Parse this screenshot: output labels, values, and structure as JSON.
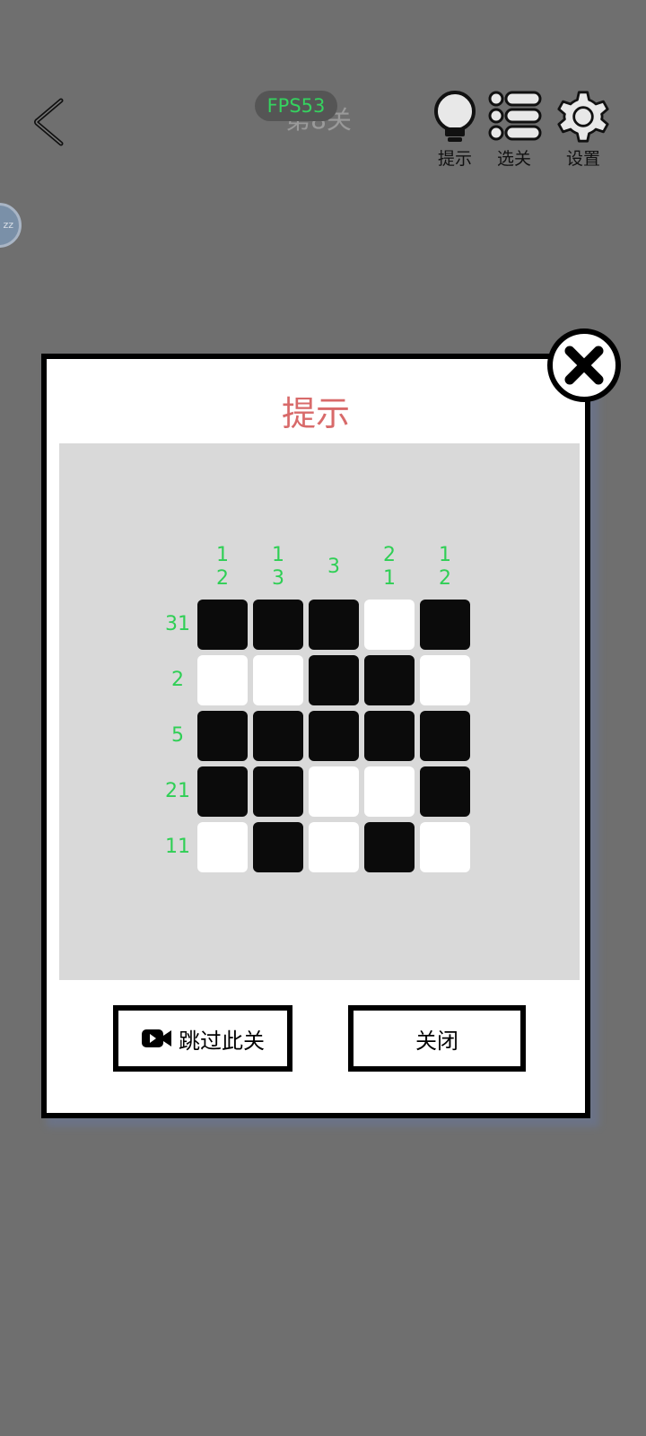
{
  "header": {
    "level_title": "第8关",
    "fps": "FPS53",
    "hint_label": "提示",
    "select_label": "选关",
    "settings_label": "设置",
    "side_bubble": "zz"
  },
  "dialog": {
    "title": "提示",
    "skip_button": "跳过此关",
    "close_button": "关闭"
  },
  "puzzle": {
    "column_clues": [
      [
        "1",
        "2"
      ],
      [
        "1",
        "3"
      ],
      [
        "3"
      ],
      [
        "2",
        "1"
      ],
      [
        "1",
        "2"
      ]
    ],
    "row_clues": [
      "31",
      "2",
      "5",
      "21",
      "11"
    ],
    "grid": [
      [
        1,
        1,
        1,
        0,
        1
      ],
      [
        0,
        0,
        1,
        1,
        0
      ],
      [
        1,
        1,
        1,
        1,
        1
      ],
      [
        1,
        1,
        0,
        0,
        1
      ],
      [
        0,
        1,
        0,
        1,
        0
      ]
    ]
  },
  "colors": {
    "background": "#6f6f6f",
    "clue": "#2fcf55",
    "title": "#d86a6a",
    "filled": "#0b0b0b",
    "empty": "#ffffff"
  }
}
